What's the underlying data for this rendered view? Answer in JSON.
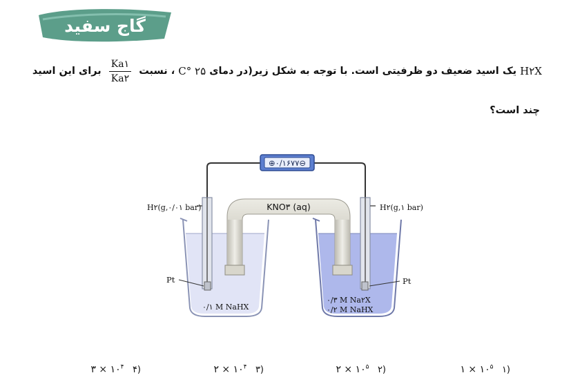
{
  "brand": {
    "logo_text": "گاج سفید"
  },
  "question": {
    "formula": "H۲X",
    "text_before": "یک اسید ضعیف دو ظرفیتی است. با توجه به شکل زیر(در دمای",
    "temperature": "۲۵ °C",
    "text_mid": "، نسبت",
    "ratio_numerator": "Ka۱",
    "ratio_denominator": "Ka۲",
    "text_after": "برای این اسید",
    "line2": "چند است؟"
  },
  "diagram": {
    "voltmeter_reading": "⊕۰/۱۶۷۷⊖",
    "salt_bridge_label": "KNO۳ (aq)",
    "left_gas_label": "H۲(g,۰/۰۱ bar)",
    "right_gas_label": "H۲(g,۱ bar)",
    "left_electrode_label": "Pt",
    "right_electrode_label": "Pt",
    "left_solution": "۰/۱ M NaHX",
    "right_solution_line1": "۰/۳ M Na۲X",
    "right_solution_line2": "۰/۲ M NaHX",
    "colors": {
      "left_liquid": "#dfe3f5",
      "right_liquid": "#aab4ea",
      "bridge": "#d8d6cc",
      "voltmeter": "#5d7fd0"
    }
  },
  "options": [
    {
      "number": "۱)",
      "base": "۱ × ۱۰",
      "exp": "۵"
    },
    {
      "number": "۲)",
      "base": "۲ × ۱۰",
      "exp": "۵"
    },
    {
      "number": "۳)",
      "base": "۲ × ۱۰",
      "exp": "۴"
    },
    {
      "number": "۴)",
      "base": "۳ × ۱۰",
      "exp": "۴"
    }
  ]
}
